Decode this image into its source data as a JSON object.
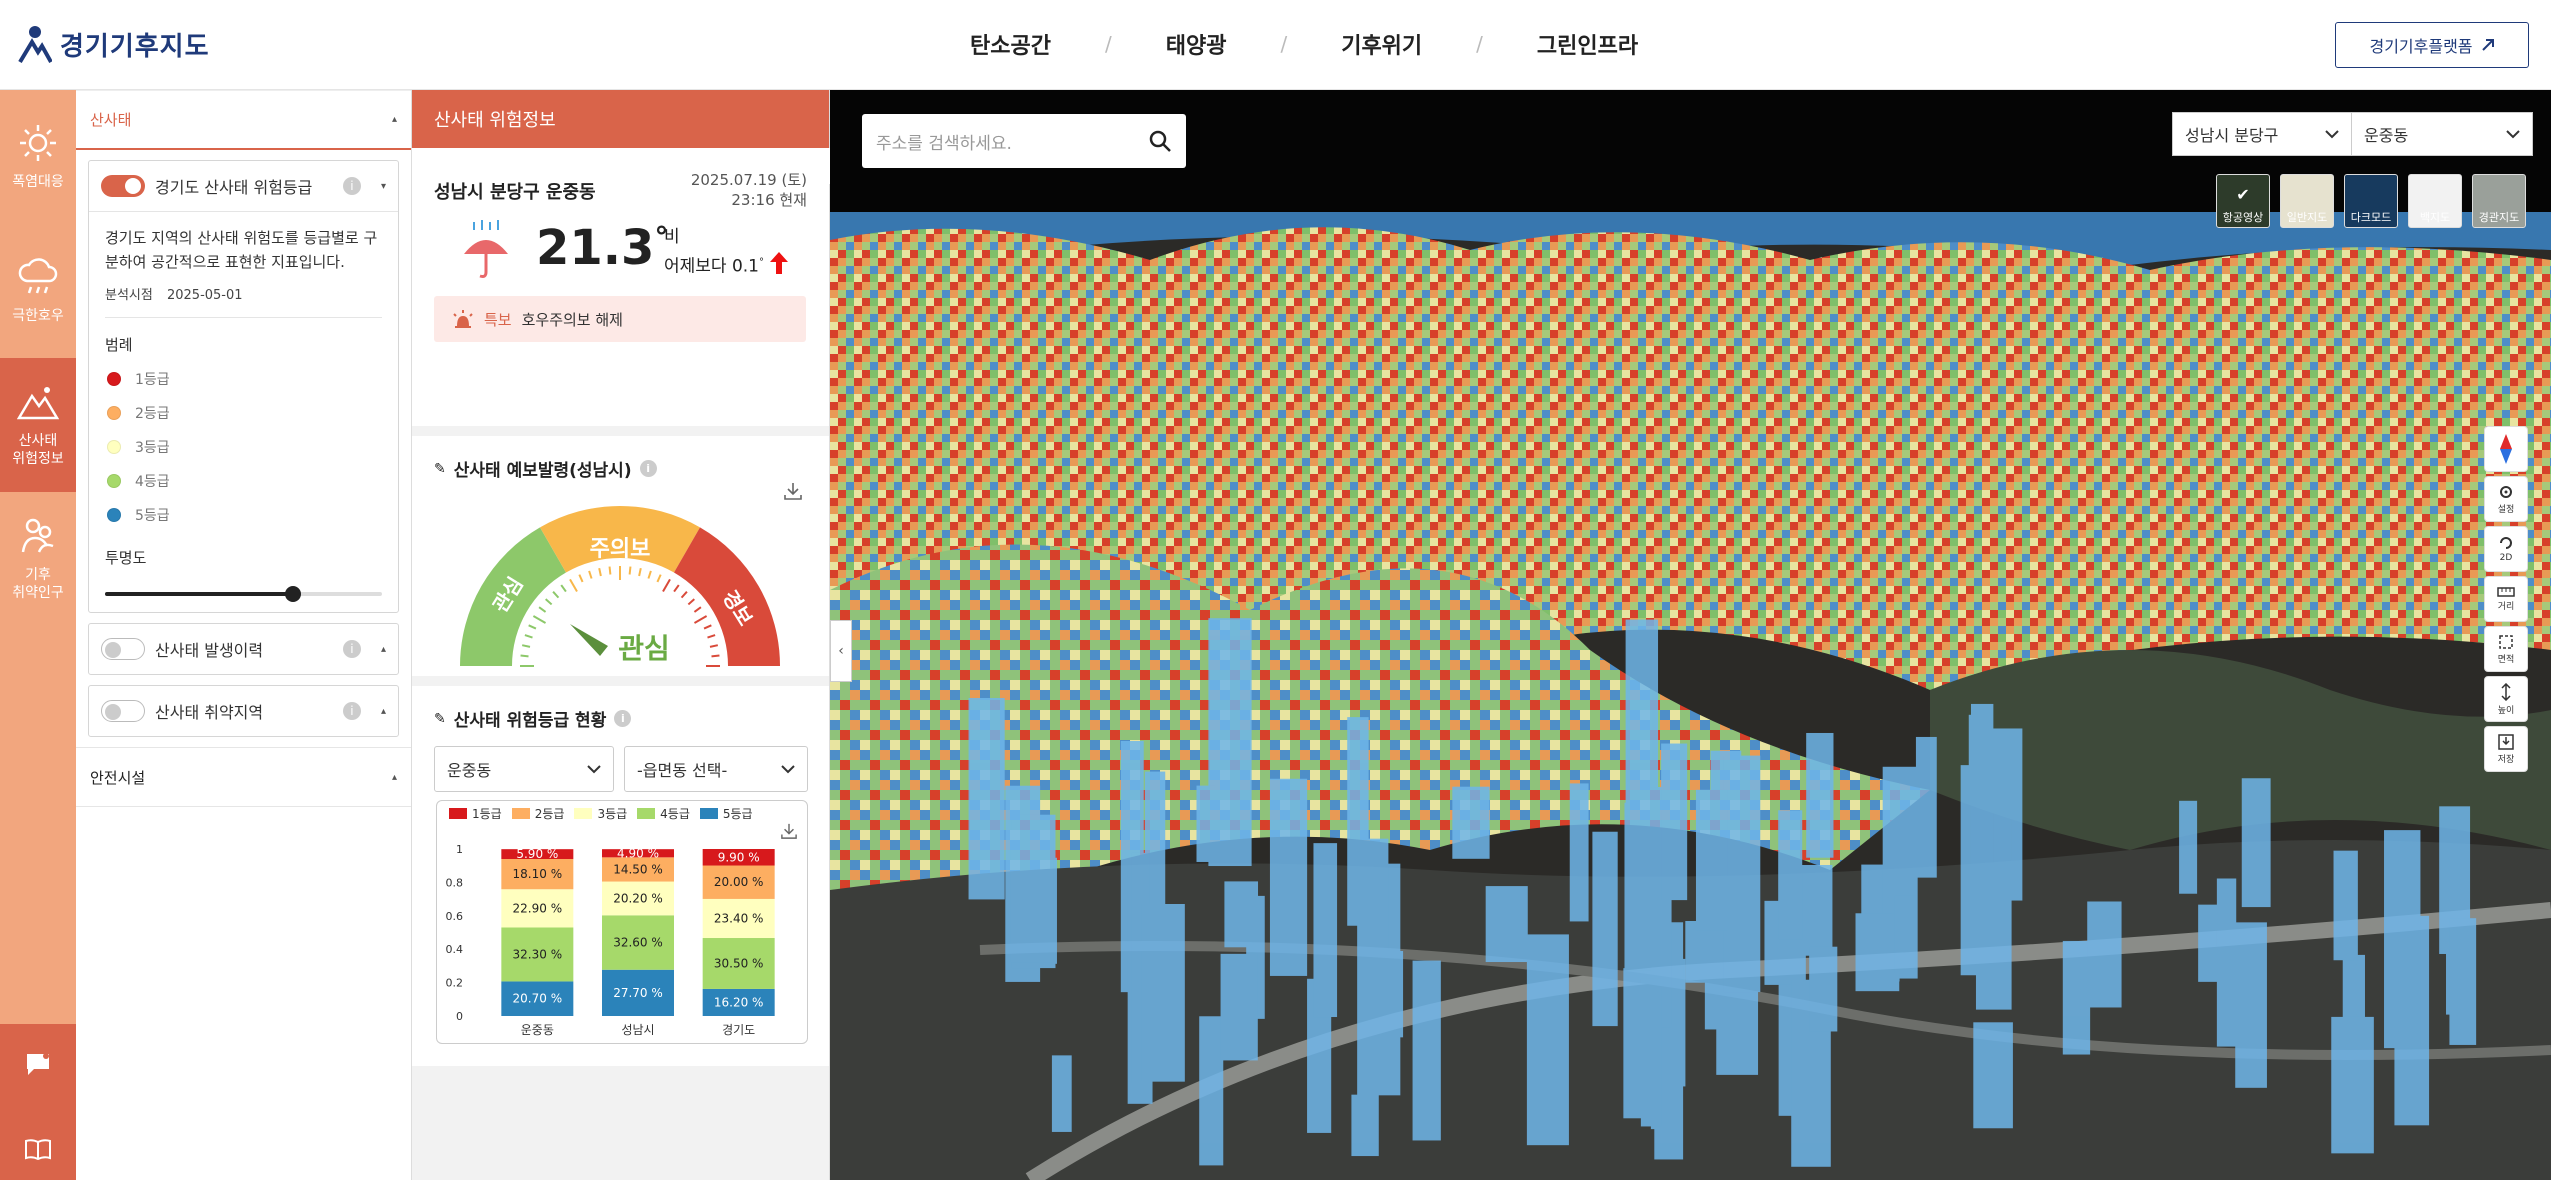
{
  "header": {
    "logo_text": "경기기후지도",
    "nav": [
      "탄소공간",
      "태양광",
      "기후위기",
      "그린인프라"
    ],
    "platform_button": "경기기후플랫폼"
  },
  "rail": {
    "items": [
      {
        "label": "폭염대응",
        "icon": "sun-icon"
      },
      {
        "label": "극한호우",
        "icon": "cloud-rain-icon"
      },
      {
        "label": "산사태\n위험정보",
        "icon": "mountain-icon"
      },
      {
        "label": "기후\n취약인구",
        "icon": "people-icon"
      }
    ],
    "bottom_icons": [
      "feedback-icon",
      "manual-book-icon"
    ]
  },
  "layers": {
    "section_title": "산사태",
    "main_layer": {
      "label": "경기도 산사태 위험등급",
      "enabled": true,
      "description": "경기도 지역의 산사태 위험도를 등급별로 구분하여 공간적으로 표현한 지표입니다.",
      "analysis_label": "분석시점",
      "analysis_date": "2025-05-01",
      "legend_title": "범례",
      "legend": [
        {
          "label": "1등급",
          "color": "#d7191c"
        },
        {
          "label": "2등급",
          "color": "#fdae61"
        },
        {
          "label": "3등급",
          "color": "#ffffbf"
        },
        {
          "label": "4등급",
          "color": "#a6d96a"
        },
        {
          "label": "5등급",
          "color": "#2b83ba"
        }
      ],
      "opacity_title": "투명도",
      "opacity_value": 0.69
    },
    "other_layers": [
      {
        "label": "산사태 발생이력",
        "enabled": false
      },
      {
        "label": "산사태 취약지역",
        "enabled": false
      }
    ],
    "safety_section": "안전시설"
  },
  "info": {
    "header": "산사태 위험정보",
    "location": "성남시 분당구 운중동",
    "date": "2025.07.19 (토)",
    "time": "23:16 현재",
    "temperature": "21.3",
    "degree": "°",
    "weather": "비",
    "compare": "어제보다 0.1",
    "alert_label": "특보",
    "alert_text": "호우주의보 해제",
    "forecast_title": "산사태 예보발령(성남시)",
    "gauge_segments": [
      "관심",
      "주의보",
      "경보"
    ],
    "gauge_current": "관심",
    "grade_title": "산사태 위험등급 현황",
    "select_dong": "운중동",
    "select_emd": "-읍면동 선택-"
  },
  "chart_data": {
    "type": "bar",
    "stacked": true,
    "categories": [
      "운중동",
      "성남시",
      "경기도"
    ],
    "series": [
      {
        "name": "5등급",
        "values": [
          20.7,
          27.7,
          16.2
        ],
        "color": "#2b83ba"
      },
      {
        "name": "4등급",
        "values": [
          32.3,
          32.6,
          30.5
        ],
        "color": "#a6d96a"
      },
      {
        "name": "3등급",
        "values": [
          22.9,
          20.2,
          23.4
        ],
        "color": "#ffffbf"
      },
      {
        "name": "2등급",
        "values": [
          18.1,
          14.5,
          20.0
        ],
        "color": "#fdae61"
      },
      {
        "name": "1등급",
        "values": [
          5.9,
          4.9,
          9.9
        ],
        "color": "#d7191c"
      }
    ],
    "legend_order": [
      "1등급",
      "2등급",
      "3등급",
      "4등급",
      "5등급"
    ],
    "yticks": [
      "0",
      "0.2",
      "0.4",
      "0.6",
      "0.8",
      "1"
    ],
    "ylim": [
      0,
      1
    ]
  },
  "map": {
    "search_placeholder": "주소를 검색하세요.",
    "select_sigungu": "성남시 분당구",
    "select_dong": "운중동",
    "base_maps": [
      {
        "label": "항공영상",
        "selected": true
      },
      {
        "label": "일반지도",
        "selected": false
      },
      {
        "label": "다크모드",
        "selected": false
      },
      {
        "label": "백지도",
        "selected": false
      },
      {
        "label": "경관지도",
        "selected": false
      }
    ],
    "tools": [
      {
        "label": "",
        "icon": "compass-icon"
      },
      {
        "label": "설정",
        "icon": "settings-icon"
      },
      {
        "label": "2D",
        "icon": "rotate-icon"
      },
      {
        "label": "거리",
        "icon": "ruler-icon"
      },
      {
        "label": "면적",
        "icon": "area-icon"
      },
      {
        "label": "높이",
        "icon": "height-icon"
      },
      {
        "label": "저장",
        "icon": "save-icon"
      }
    ]
  }
}
